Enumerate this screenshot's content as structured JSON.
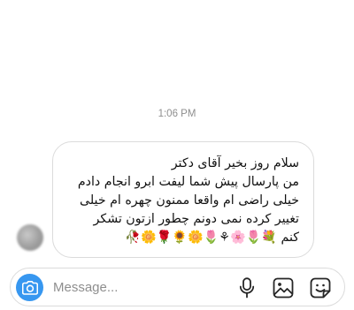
{
  "thread": {
    "timestamp": "1:06 PM",
    "message": {
      "lines": [
        "سلام روز بخیر آقای دکتر",
        "من پارسال پیش شما لیفت ابرو انجام دادم",
        "خیلی راضی ام واقعا ممنون چهره ام خیلی",
        "تغییر کرده نمی دونم چطور ازتون تشکر",
        "کنم 💐🌷🌸⚘🌷🌼🌻🌹🌼🥀"
      ]
    }
  },
  "composer": {
    "placeholder": "Message..."
  },
  "colors": {
    "accent": "#3797f0",
    "border": "#dbdbdb",
    "muted_text": "#8e8e8e"
  },
  "icons": {
    "camera": "camera-icon",
    "microphone": "microphone-icon",
    "gallery": "gallery-icon",
    "sticker": "sticker-icon"
  }
}
